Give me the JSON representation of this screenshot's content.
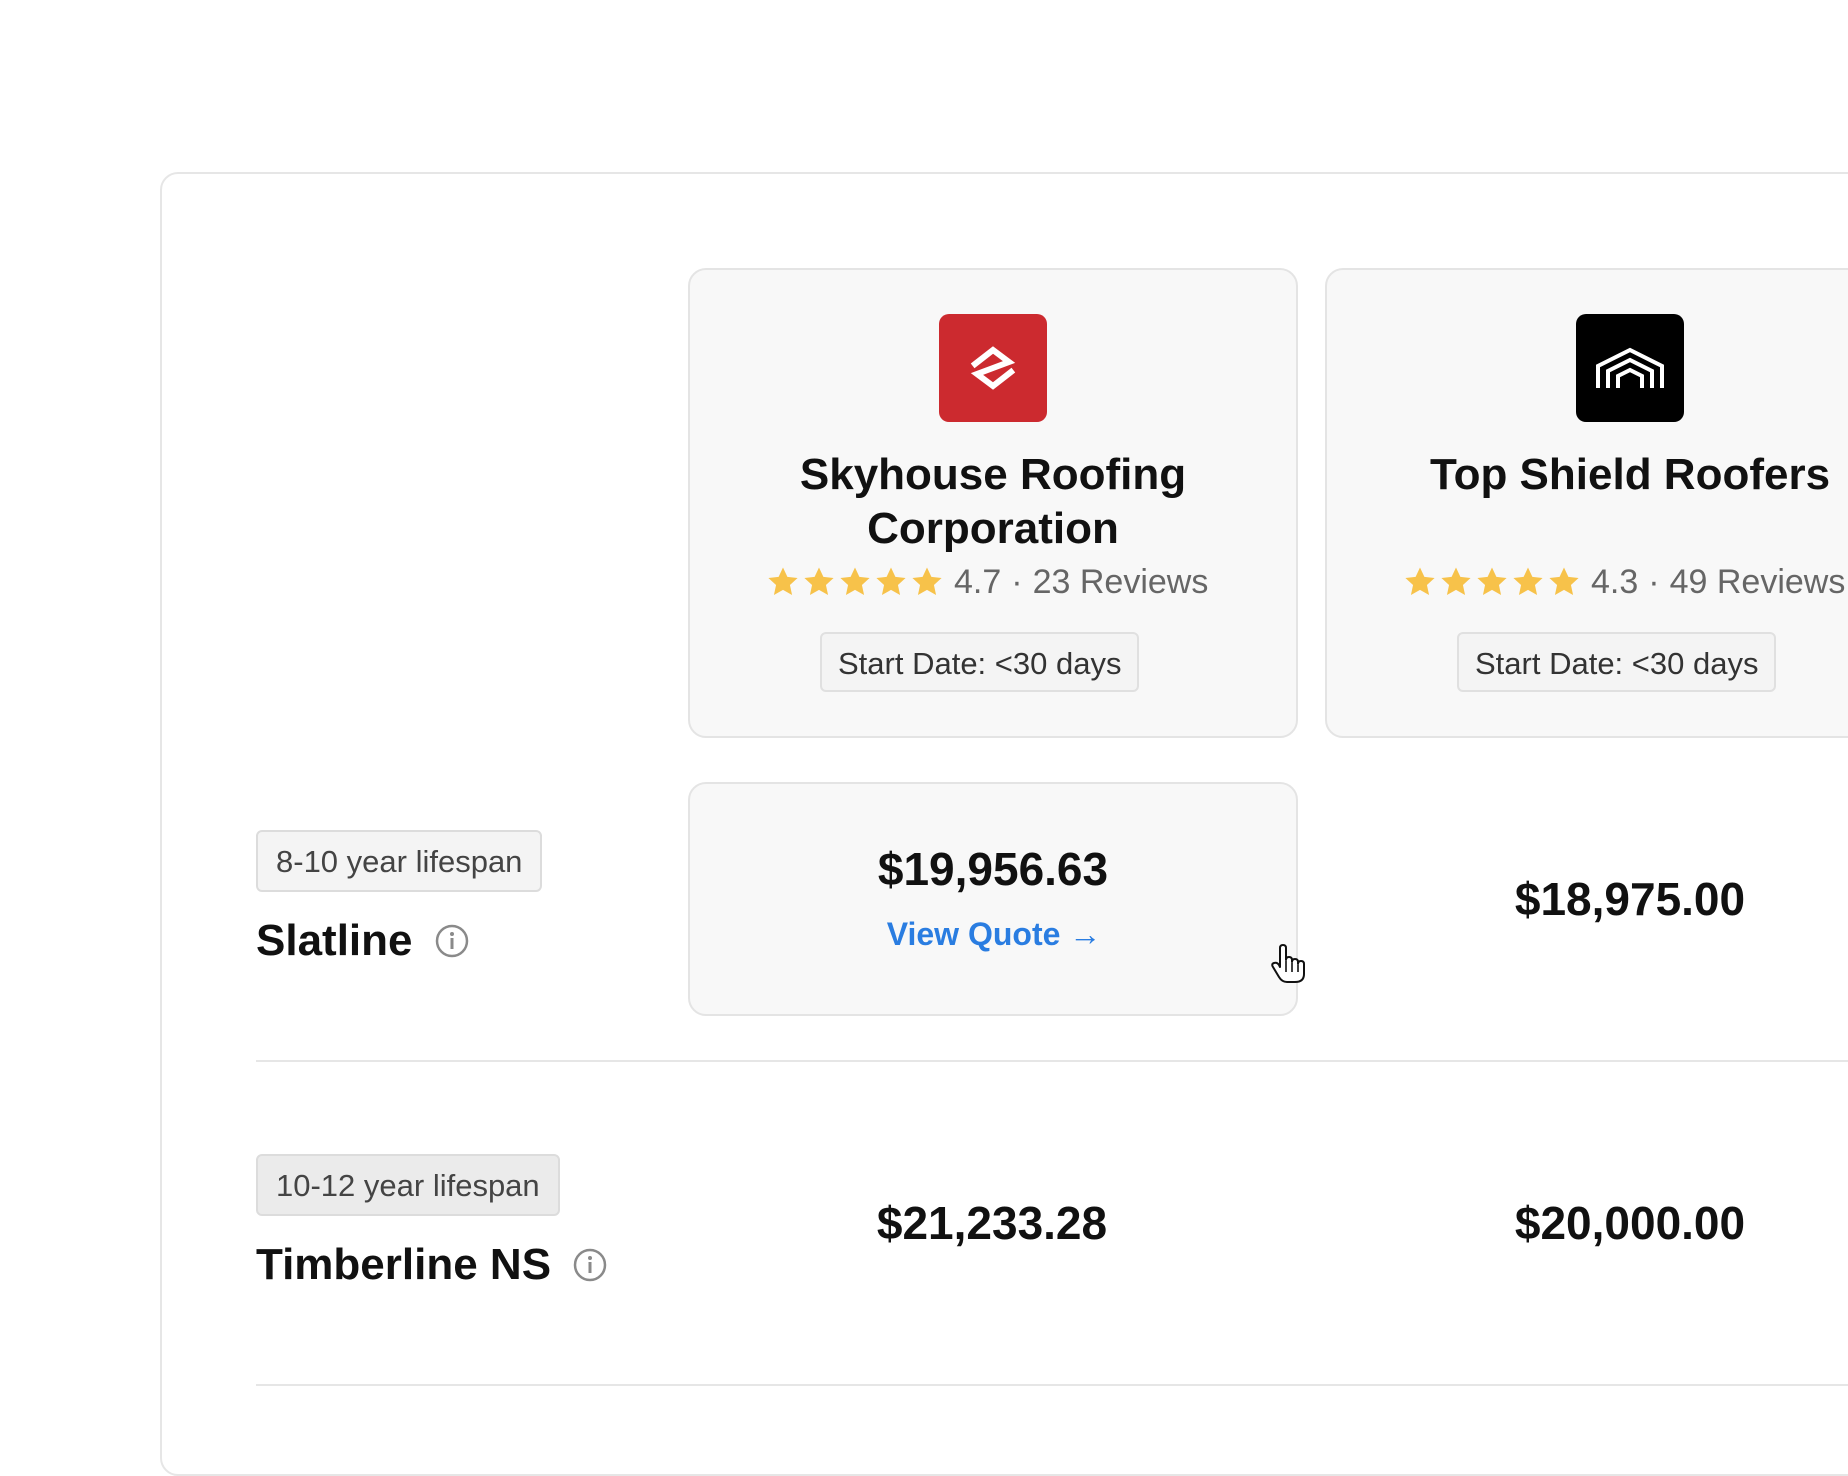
{
  "companies": [
    {
      "name": "Skyhouse Roofing Corporation",
      "rating": "4.7",
      "reviews": "23 Reviews",
      "start_date": "Start Date: <30 days",
      "logo_icon": "skyhouse-logo-icon",
      "logo_color": "#cc2a2f"
    },
    {
      "name": "Top Shield Roofers",
      "rating": "4.3",
      "reviews": "49 Reviews",
      "start_date": "Start Date: <30 days",
      "logo_icon": "top-shield-logo-icon",
      "logo_color": "#000000"
    }
  ],
  "star_color": "#f7c24a",
  "products": [
    {
      "lifespan": "8-10 year lifespan",
      "name": "Slatline",
      "prices": [
        "$19,956.63",
        "$18,975.00"
      ],
      "view_quote": "View Quote"
    },
    {
      "lifespan": "10-12 year lifespan",
      "name": "Timberline NS",
      "prices": [
        "$21,233.28",
        "$20,000.00"
      ]
    }
  ],
  "link_color": "#2a7de1"
}
